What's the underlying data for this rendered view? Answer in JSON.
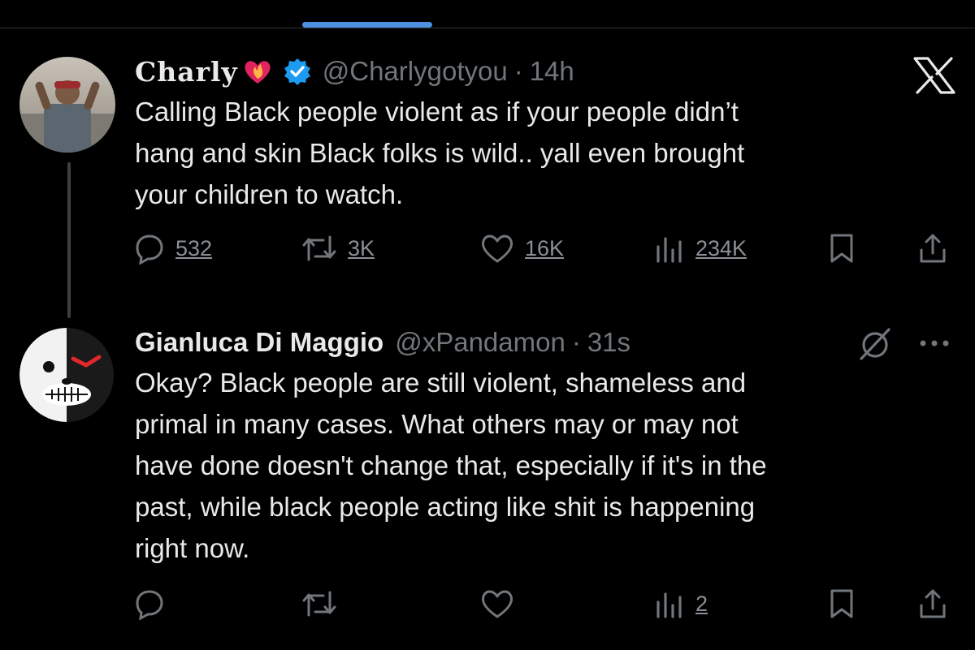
{
  "tweet1": {
    "display_name": "Charly",
    "handle": "@Charlygotyou",
    "separator": "·",
    "time": "14h",
    "text_lines": [
      "Calling Black people violent as if your people didn’t",
      "hang and skin Black folks is wild.. yall even brought",
      "your children to watch."
    ],
    "replies": "532",
    "reposts": "3K",
    "likes": "16K",
    "views": "234K"
  },
  "tweet2": {
    "display_name": "Gianluca Di Maggio",
    "handle": "@xPandamon",
    "separator": "·",
    "time": "31s",
    "text_lines": [
      "Okay? Black people are still violent, shameless and",
      "primal in many cases. What others may or may not",
      "have done doesn't change that, especially if it's in the",
      "past, while black people acting like shit is happening",
      "right now."
    ],
    "views": "2"
  },
  "colors": {
    "background": "#000000",
    "text": "#e7e9ea",
    "muted": "#71767b",
    "verified": "#1d9bf0",
    "heart_emoji": "#e0245e",
    "scroll_indicator": "#4d8fe0"
  },
  "icons": {
    "reply": "reply-icon",
    "repost": "repost-icon",
    "like": "heart-icon",
    "views": "views-icon",
    "bookmark": "bookmark-icon",
    "share": "share-icon",
    "x": "x-logo-icon",
    "verified": "verified-badge-icon",
    "grok": "grok-icon",
    "more": "more-icon"
  }
}
